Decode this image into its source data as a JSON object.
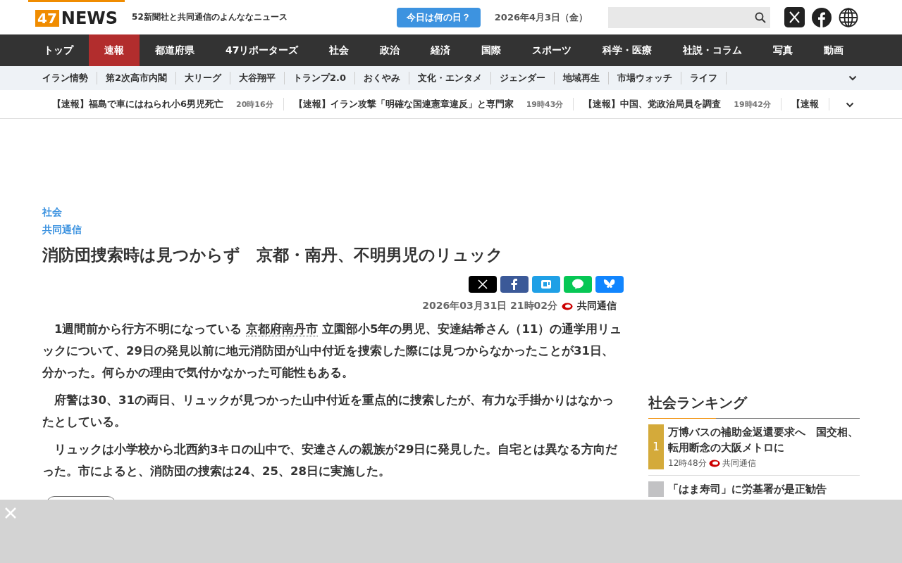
{
  "header": {
    "logo_number": "47",
    "logo_word": "NEWS",
    "tagline": "52新聞社と共同通信のよんななニュース",
    "today_button": "今日は何の日？",
    "date": "2026年4月3日（金）"
  },
  "nav": [
    {
      "label": "トップ",
      "selected": false
    },
    {
      "label": "速報",
      "selected": true
    },
    {
      "label": "都道府県",
      "selected": false
    },
    {
      "label": "47リポーターズ",
      "selected": false
    },
    {
      "label": "社会",
      "selected": false
    },
    {
      "label": "政治",
      "selected": false
    },
    {
      "label": "経済",
      "selected": false
    },
    {
      "label": "国際",
      "selected": false
    },
    {
      "label": "スポーツ",
      "selected": false
    },
    {
      "label": "科学・医療",
      "selected": false
    },
    {
      "label": "社説・コラム",
      "selected": false
    },
    {
      "label": "写真",
      "selected": false
    },
    {
      "label": "動画",
      "selected": false
    }
  ],
  "topics": [
    "イラン情勢",
    "第2次高市内閣",
    "大リーグ",
    "大谷翔平",
    "トランプ2.0",
    "おくやみ",
    "文化・エンタメ",
    "ジェンダー",
    "地域再生",
    "市場ウォッチ",
    "ライフ"
  ],
  "ticker": [
    {
      "title": "【速報】福島で車にはねられ小6男児死亡",
      "time": "20時16分"
    },
    {
      "title": "【速報】イラン攻撃「明確な国連憲章違反」と専門家",
      "time": "19時43分"
    },
    {
      "title": "【速報】中国、党政治局員を調査",
      "time": "19時42分"
    },
    {
      "title": "【速報"
    }
  ],
  "article": {
    "category": "社会",
    "source": "共同通信",
    "title": "消防団捜索時は見つからず　京都・南丹、不明男児のリュック",
    "datetime": "2026年03月31日 21時02分",
    "publisher": "共同通信",
    "paragraphs": [
      [
        {
          "kind": "text",
          "text": "　1週間前から行方不明になっている "
        },
        {
          "kind": "link",
          "text": "京都府南丹市"
        },
        {
          "kind": "text",
          "text": " 立園部小5年の男児、安達結希さん（11）の通学用リュックについて、29日の発見以前に地元消防団が山中付近を捜索した際には見つからなかったことが31日、分かった。何らかの理由で気付かなかった可能性もある。"
        }
      ],
      [
        {
          "kind": "text",
          "text": "　府警は30、31の両日、リュックが見つかった山中付近を重点的に捜索したが、有力な手掛かりはなかったとしている。"
        }
      ],
      [
        {
          "kind": "text",
          "text": "　リュックは小学校から北西約3キロの山中で、安達さんの親族が29日に発見した。自宅とは異なる方向だった。市によると、消防団の捜索は24、25、28日に実施した。"
        }
      ]
    ]
  },
  "ranking": {
    "title": "社会ランキング",
    "items": [
      {
        "rank": "1",
        "color": "#d4aa3a",
        "title": "万博バスの補助金返還要求へ　国交相、転用断念の大阪メトロに",
        "time": "12時48分",
        "source": "共同通信"
      },
      {
        "color": "#c2c2c4",
        "title": "「はま寿司」に労基署が是正勧告"
      }
    ]
  }
}
